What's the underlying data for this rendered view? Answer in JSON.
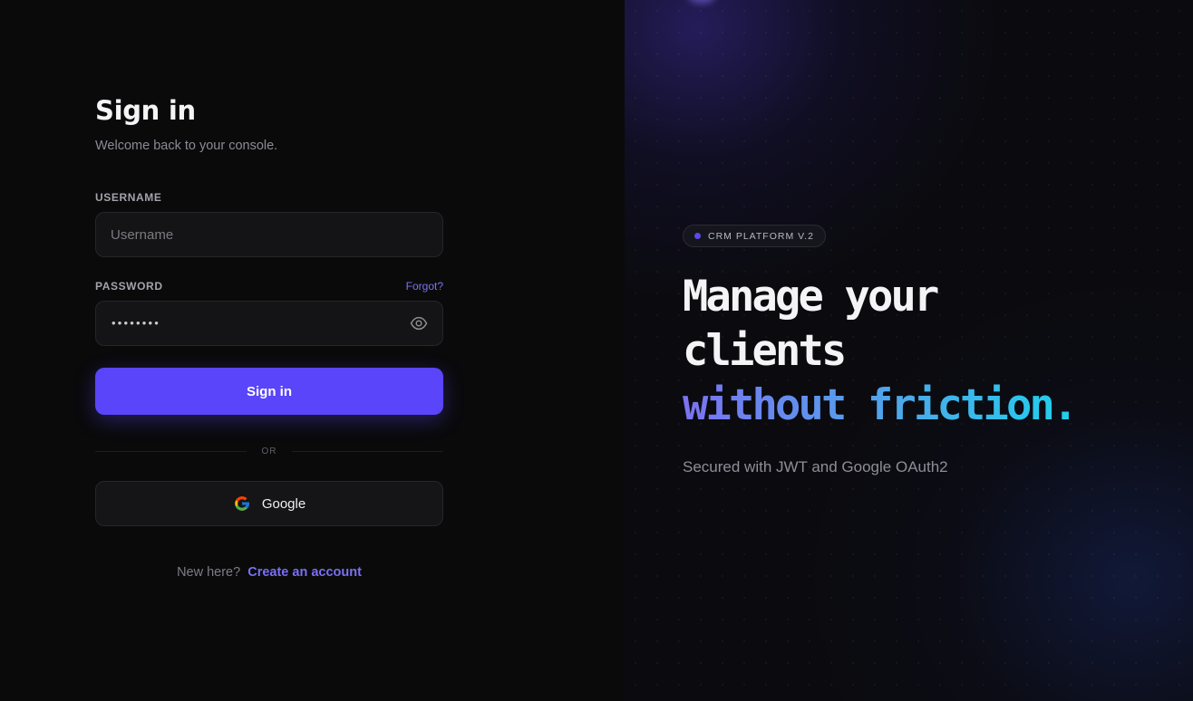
{
  "signin": {
    "title": "Sign in",
    "subtitle": "Welcome back to your console.",
    "username_label": "USERNAME",
    "username_placeholder": "Username",
    "username_value": "",
    "password_label": "PASSWORD",
    "forgot_label": "Forgot?",
    "password_masked": "••••••••",
    "submit_label": "Sign in",
    "divider_label": "OR",
    "google_label": "Google",
    "signup_prompt": "New here?",
    "signup_link": "Create an account"
  },
  "hero": {
    "badge": "CRM PLATFORM V.2",
    "headline_line1": "Manage your",
    "headline_line2": "clients",
    "headline_accent": "without friction.",
    "tagline": "Secured with JWT and Google OAuth2"
  },
  "colors": {
    "primary": "#5a45fa",
    "link": "#7a70f3",
    "accent_gradient_start": "#7b72f2",
    "accent_gradient_end": "#1fd0ec"
  },
  "icons": {
    "password_toggle": "eye-icon",
    "google": "google-logo-icon",
    "badge": "status-dot-icon"
  }
}
